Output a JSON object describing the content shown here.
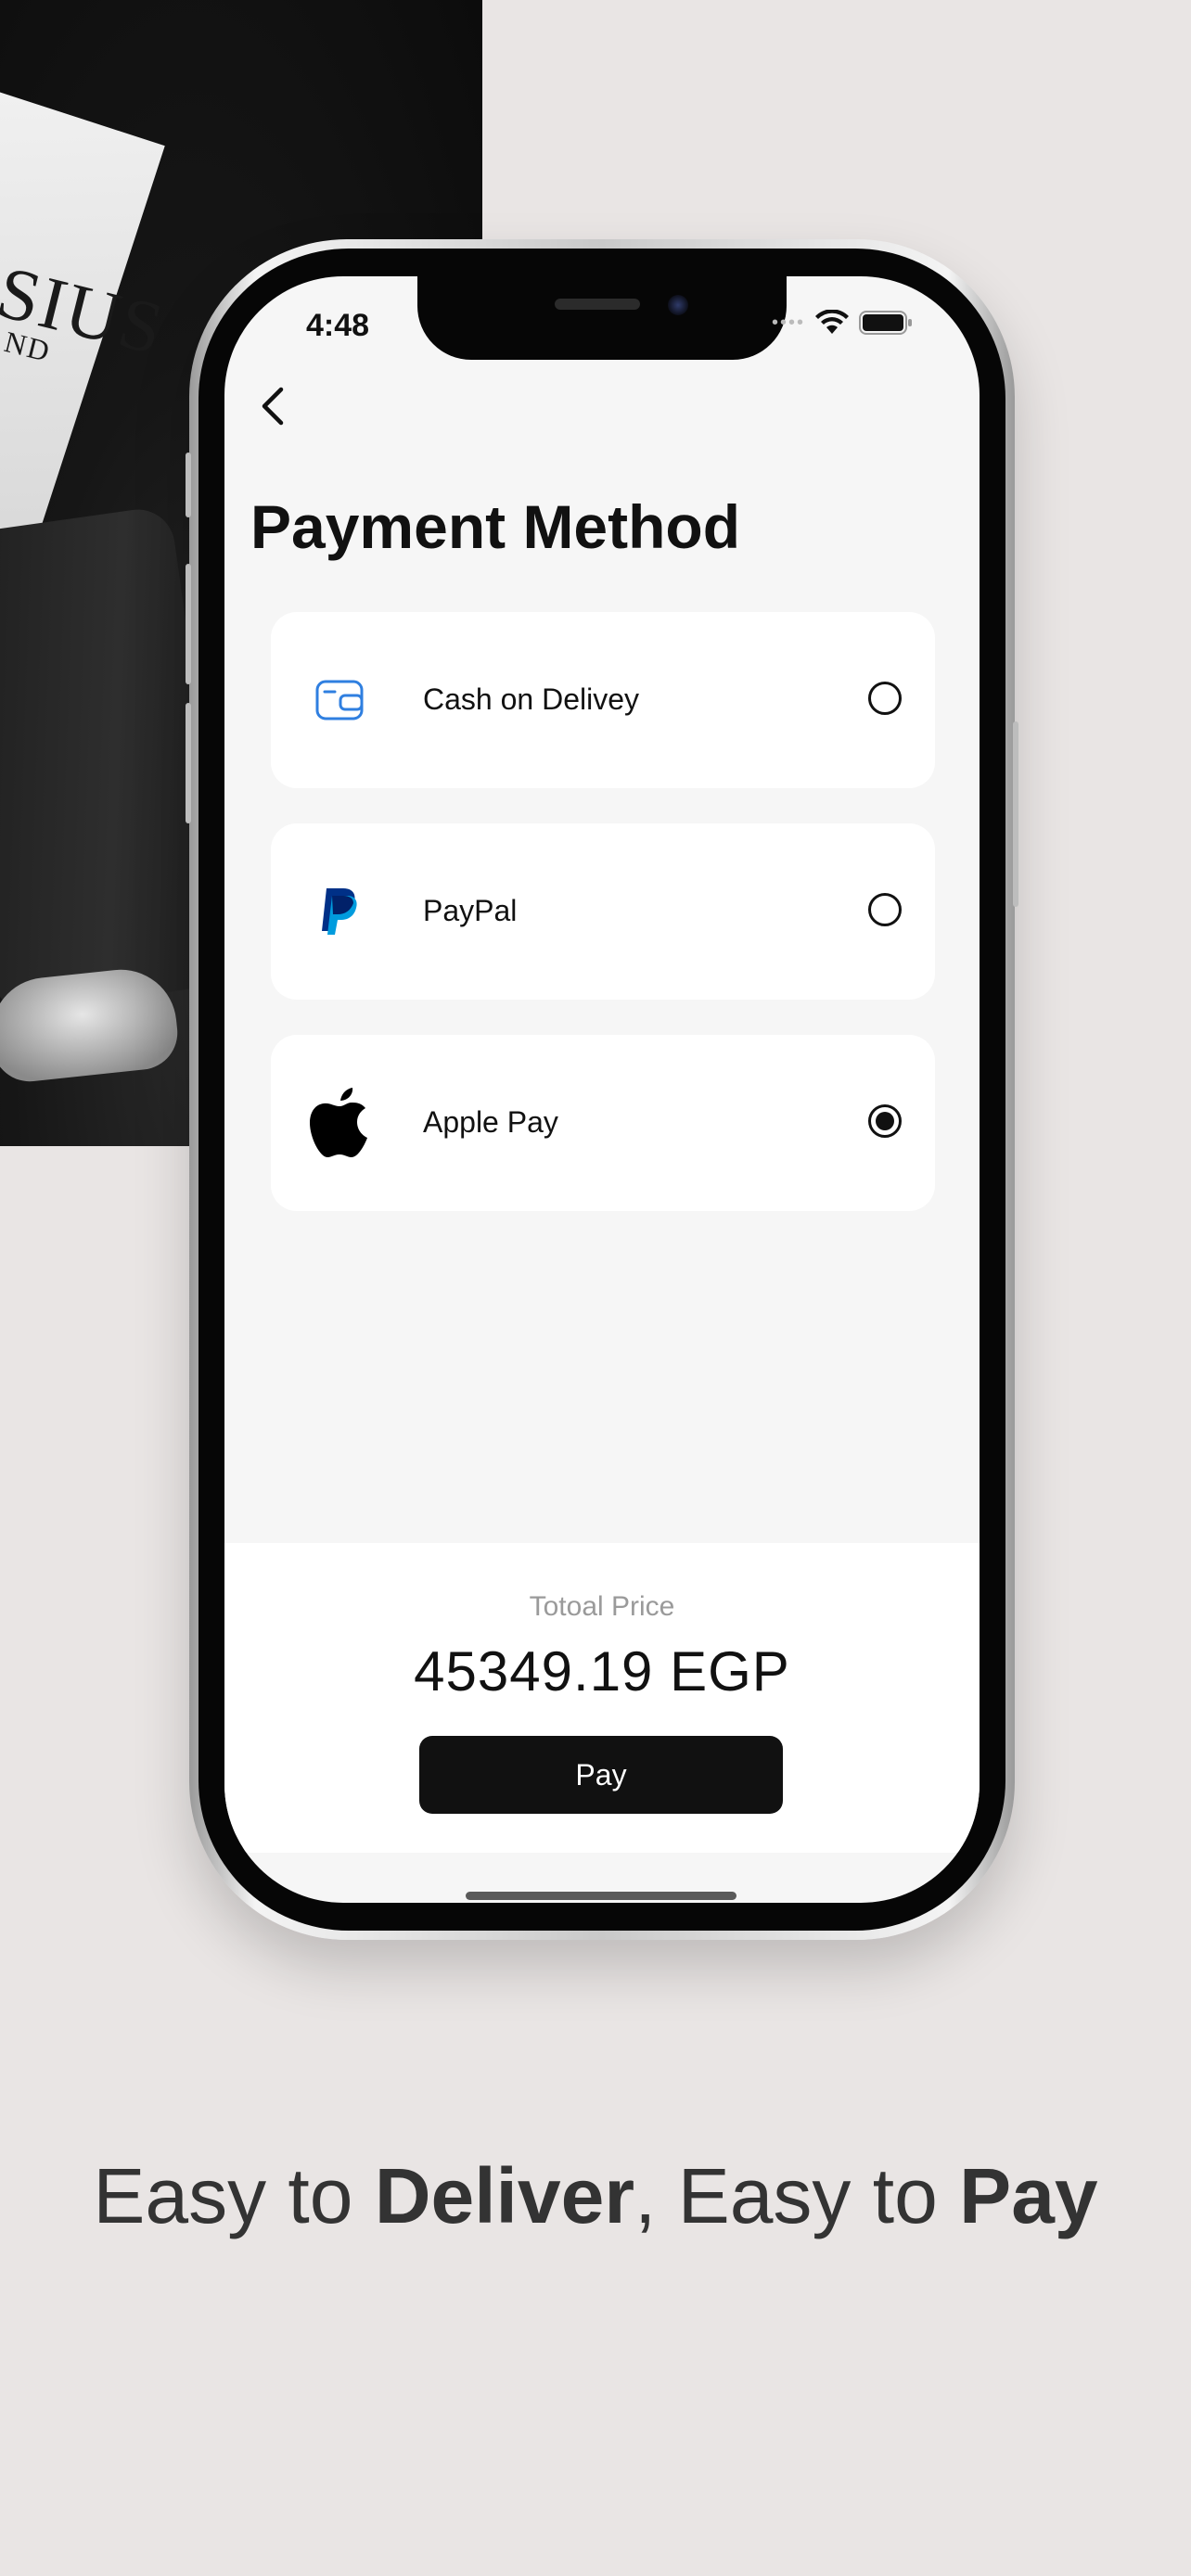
{
  "background": {
    "card_text": "SIUS",
    "card_subtext": "ND"
  },
  "status_bar": {
    "time": "4:48"
  },
  "header": {
    "title": "Payment Method"
  },
  "payment_options": [
    {
      "label": "Cash on Delivey",
      "icon": "wallet-icon",
      "selected": false
    },
    {
      "label": "PayPal",
      "icon": "paypal-icon",
      "selected": false
    },
    {
      "label": "Apple Pay",
      "icon": "apple-icon",
      "selected": true
    }
  ],
  "summary": {
    "total_label": "Totoal Price",
    "total_value": "45349.19 EGP",
    "pay_label": "Pay"
  },
  "tagline": {
    "part1": "Easy to ",
    "bold1": "Deliver",
    "part2": ", Easy to ",
    "bold2": "Pay"
  },
  "colors": {
    "background": "#e9e5e4",
    "accent": "#111111",
    "wallet_icon": "#2f7fe0",
    "paypal_dark": "#003087",
    "paypal_light": "#009cde"
  }
}
